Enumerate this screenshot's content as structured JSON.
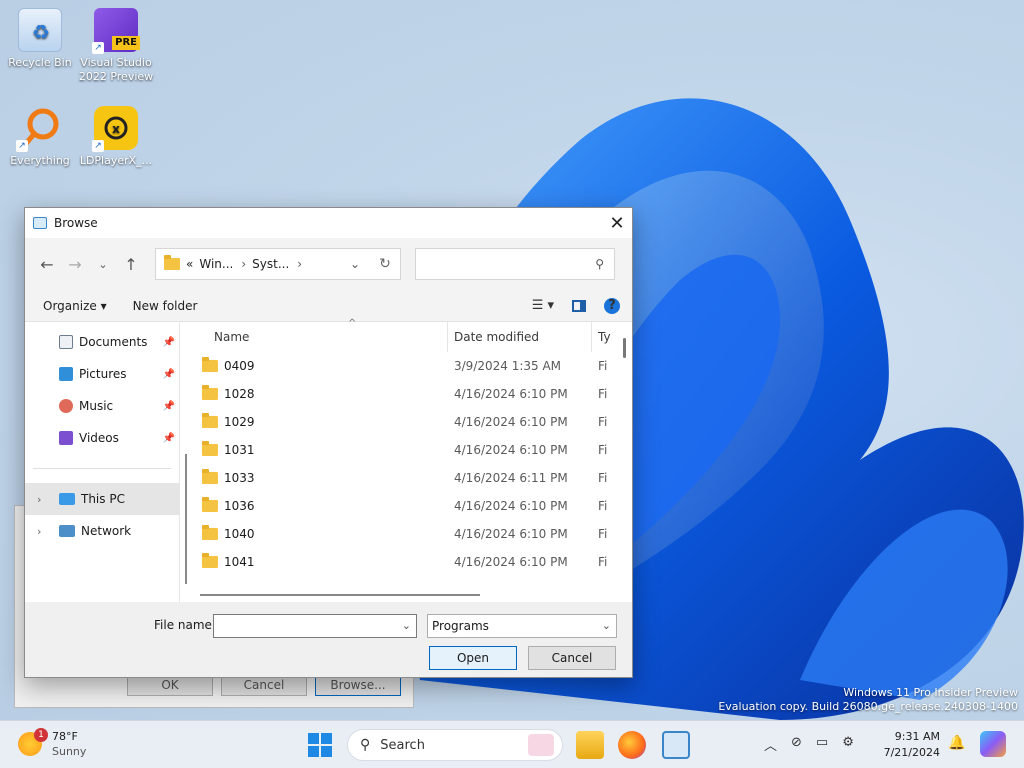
{
  "desktop": {
    "icons": [
      {
        "label_line1": "Recycle Bin",
        "label_line2": ""
      },
      {
        "label_line1": "Visual Studio",
        "label_line2": "2022 Preview"
      },
      {
        "label_line1": "Everything",
        "label_line2": ""
      },
      {
        "label_line1": "LDPlayerX_...",
        "label_line2": ""
      }
    ],
    "vs_badge": "PRE",
    "watermark_line1": "Windows 11 Pro Insider Preview",
    "watermark_line2": "Evaluation copy. Build 26080.ge_release.240308-1400"
  },
  "back_window": {
    "ok_label": "OK",
    "cancel_label": "Cancel",
    "browse_label": "Browse..."
  },
  "dialog": {
    "title": "Browse",
    "address": {
      "chevrons": "«",
      "crumbs": [
        "Win...",
        "Syst..."
      ]
    },
    "search_placeholder": "",
    "toolbar": {
      "organize": "Organize ▾",
      "new_folder": "New folder"
    },
    "nav": {
      "items": [
        {
          "label": "Documents",
          "color": "#6b7c93"
        },
        {
          "label": "Pictures",
          "color": "#2f8fd8"
        },
        {
          "label": "Music",
          "color": "#e06a5a"
        },
        {
          "label": "Videos",
          "color": "#7b4fd0"
        }
      ],
      "this_pc": "This PC",
      "network": "Network"
    },
    "columns": {
      "name": "Name",
      "date": "Date modified",
      "type": "Ty"
    },
    "rows": [
      {
        "name": "0409",
        "date": "3/9/2024 1:35 AM",
        "type": "Fi"
      },
      {
        "name": "1028",
        "date": "4/16/2024 6:10 PM",
        "type": "Fi"
      },
      {
        "name": "1029",
        "date": "4/16/2024 6:10 PM",
        "type": "Fi"
      },
      {
        "name": "1031",
        "date": "4/16/2024 6:10 PM",
        "type": "Fi"
      },
      {
        "name": "1033",
        "date": "4/16/2024 6:11 PM",
        "type": "Fi"
      },
      {
        "name": "1036",
        "date": "4/16/2024 6:10 PM",
        "type": "Fi"
      },
      {
        "name": "1040",
        "date": "4/16/2024 6:10 PM",
        "type": "Fi"
      },
      {
        "name": "1041",
        "date": "4/16/2024 6:10 PM",
        "type": "Fi"
      }
    ],
    "footer": {
      "file_name_label": "File name:",
      "file_name_value": "",
      "file_type": "Programs",
      "open_label": "Open",
      "cancel_label": "Cancel"
    }
  },
  "taskbar": {
    "weather_temp": "78°F",
    "weather_cond": "Sunny",
    "weather_badge": "1",
    "search_label": "Search",
    "time": "9:31 AM",
    "date": "7/21/2024"
  }
}
